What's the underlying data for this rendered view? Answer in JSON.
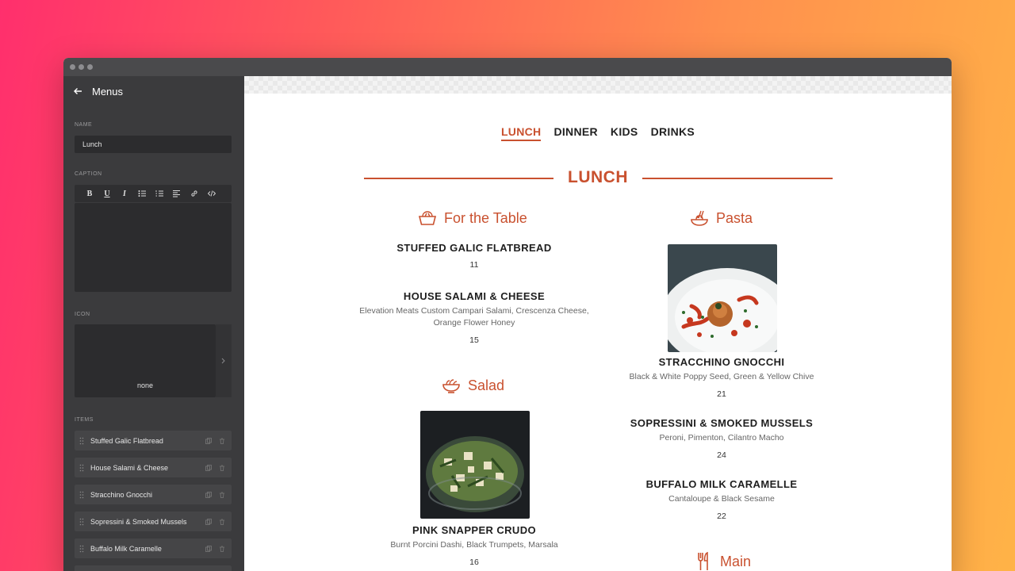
{
  "sidebar": {
    "title": "Menus",
    "name_label": "NAME",
    "name_value": "Lunch",
    "caption_label": "CAPTION",
    "icon_label": "ICON",
    "icon_value": "none",
    "items_label": "ITEMS",
    "items": [
      {
        "label": "Stuffed Galic Flatbread"
      },
      {
        "label": "House Salami & Cheese"
      },
      {
        "label": "Stracchino Gnocchi"
      },
      {
        "label": "Sopressini & Smoked Mussels"
      },
      {
        "label": "Buffalo Milk Caramelle"
      }
    ],
    "toolbar": {
      "bold": "B",
      "underline": "U",
      "italic": "I"
    }
  },
  "menu": {
    "tabs": [
      {
        "label": "LUNCH",
        "active": true
      },
      {
        "label": "DINNER"
      },
      {
        "label": "KIDS"
      },
      {
        "label": "DRINKS"
      }
    ],
    "section_title": "LUNCH",
    "categories": {
      "for_the_table": "For the Table",
      "pasta": "Pasta",
      "salad": "Salad",
      "main": "Main"
    },
    "dishes": {
      "flatbread": {
        "name": "STUFFED GALIC FLATBREAD",
        "price": "11"
      },
      "salami": {
        "name": "HOUSE SALAMI & CHEESE",
        "desc": "Elevation Meats Custom Campari Salami, Crescenza Cheese, Orange Flower Honey",
        "price": "15"
      },
      "crudo": {
        "name": "PINK SNAPPER CRUDO",
        "desc": "Burnt Porcini Dashi, Black Trumpets, Marsala",
        "price": "16"
      },
      "gnocchi": {
        "name": "STRACCHINO GNOCCHI",
        "desc": "Black & White Poppy Seed, Green & Yellow Chive",
        "price": "21"
      },
      "mussels": {
        "name": "SOPRESSINI & SMOKED MUSSELS",
        "desc": "Peroni, Pimenton, Cilantro Macho",
        "price": "24"
      },
      "caramelle": {
        "name": "BUFFALO MILK CARAMELLE",
        "desc": "Cantaloupe & Black Sesame",
        "price": "22"
      }
    }
  },
  "colors": {
    "accent": "#c9512f",
    "sidebar_bg": "#3b3b3d"
  }
}
